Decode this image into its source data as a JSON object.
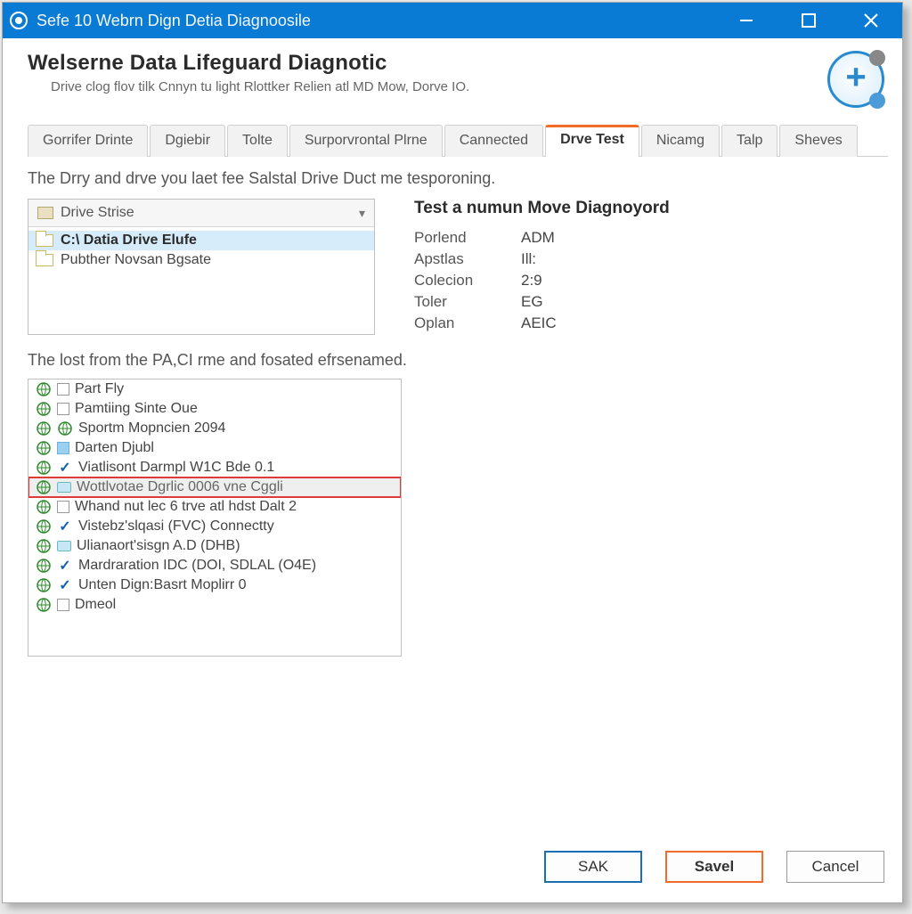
{
  "window": {
    "title": "Sefe 10 Webrn Dign Detia Diagnoosile"
  },
  "header": {
    "heading": "Welserne Data Lifeguard Diagnotic",
    "sub": "Drive clog flov tilk Cnnyn tu light Rlottker Relien atl MD Mow, Dorve IO."
  },
  "tabs": [
    {
      "label": "Gorrifer Drinte"
    },
    {
      "label": "Dgiebir"
    },
    {
      "label": "Tolte"
    },
    {
      "label": "Surporvrontal Plrne"
    },
    {
      "label": "Cannected"
    },
    {
      "label": "Drve Test",
      "active": true
    },
    {
      "label": "Nicamg"
    },
    {
      "label": "Talp"
    },
    {
      "label": "Sheves"
    }
  ],
  "intro1": "The Drry and drve you laet fee Salstal Drive Duct me tesporoning.",
  "drive_panel": {
    "header": "Drive Strise",
    "items": [
      {
        "label": "C:\\ Datia Drive Elufe",
        "selected": true
      },
      {
        "label": "Pubther Novsan Bgsate"
      }
    ]
  },
  "info": {
    "title": "Test a numun Move Diagnoyord",
    "rows": [
      {
        "k": "Porlend",
        "v": "ADM"
      },
      {
        "k": "Apstlas",
        "v": "Ill:"
      },
      {
        "k": "Colecion",
        "v": "2:9"
      },
      {
        "k": "Toler",
        "v": "EG"
      },
      {
        "k": "Oplan",
        "v": "AEIC"
      }
    ]
  },
  "intro2": "The lost from the PA,CI rme and fosated efrsenamed.",
  "list_items": [
    {
      "icons": [
        "globe",
        "box"
      ],
      "label": "Part Fly"
    },
    {
      "icons": [
        "globe",
        "box"
      ],
      "label": "Pamtiing Sinte Oue"
    },
    {
      "icons": [
        "globe",
        "globe"
      ],
      "label": "Sportm Mopncien 2094"
    },
    {
      "icons": [
        "globe",
        "blue"
      ],
      "label": "Darten Djubl"
    },
    {
      "icons": [
        "globe",
        "check"
      ],
      "label": "Viatlisont Darmpl W1C Bde 0.1"
    },
    {
      "icons": [
        "globe",
        "mon"
      ],
      "label": "Wottlvotae Dgrlic 0006 vne Cggli",
      "highlight": true
    },
    {
      "icons": [
        "globe",
        "box"
      ],
      "label": "Whand nut lec 6 trve atl hdst Dalt 2"
    },
    {
      "icons": [
        "globe",
        "check"
      ],
      "label": "Vistebz'slqasi (FVC) Connectty"
    },
    {
      "icons": [
        "globe",
        "mon"
      ],
      "label": "Ulianaort'sisgn A.D (DHB)"
    },
    {
      "icons": [
        "globe",
        "check"
      ],
      "label": "Mardraration IDC (DOI, SDLAL (O4E)"
    },
    {
      "icons": [
        "globe",
        "check"
      ],
      "label": "Unten Dign:Basrt Moplirr 0"
    },
    {
      "icons": [
        "globe",
        "box"
      ],
      "label": "Dmeol"
    }
  ],
  "buttons": {
    "ok": "SAK",
    "save": "Savel",
    "cancel": "Cancel"
  }
}
